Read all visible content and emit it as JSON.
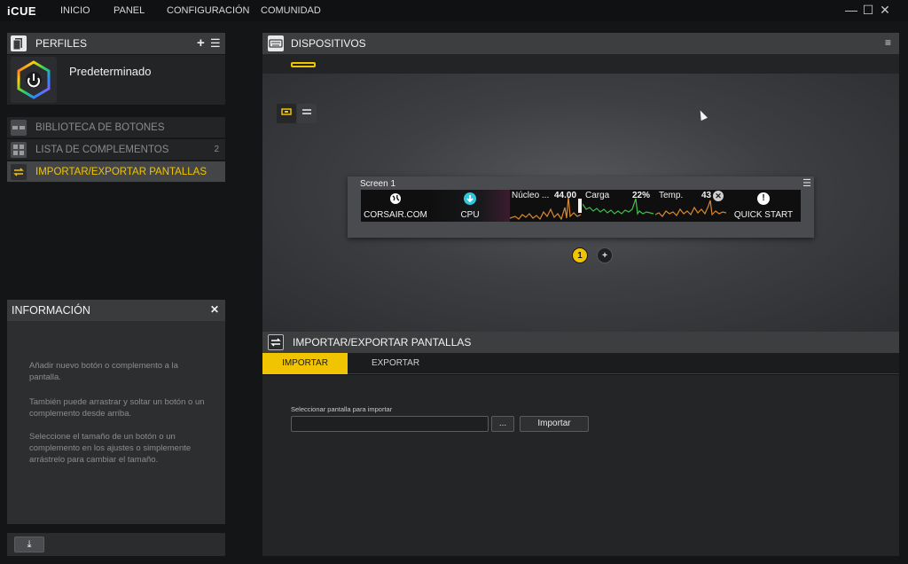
{
  "app": {
    "title": "iCUE",
    "nav": [
      "INICIO",
      "PANEL",
      "CONFIGURACIÓN",
      "COMUNIDAD"
    ],
    "window_controls": {
      "minimize": "—",
      "maximize": "☐",
      "close": "✕"
    }
  },
  "profiles": {
    "title": "PERFILES",
    "add_label": "+",
    "menu_label": "☰",
    "active_profile": "Predeterminado"
  },
  "library": {
    "items": [
      {
        "label": "BIBLIOTECA DE BOTONES",
        "count": "",
        "icon": "buttons-icon"
      },
      {
        "label": "LISTA DE COMPLEMENTOS",
        "count": "2",
        "icon": "grid-icon"
      },
      {
        "label": "IMPORTAR/EXPORTAR PANTALLAS",
        "count": "",
        "icon": "swap-icon"
      }
    ]
  },
  "info": {
    "title": "INFORMACIÓN",
    "close_label": "✕",
    "paragraphs": [
      "Añadir nuevo botón o complemento a la pantalla.",
      "También puede arrastrar y soltar un botón o un complemento desde arriba.",
      "Seleccione el tamaño de un botón o un complemento en los ajustes o simplemente arrástrelo para cambiar el tamaño."
    ],
    "download_label": "⤓"
  },
  "devices": {
    "title": "DISPOSITIVOS",
    "menu_label": "≡"
  },
  "screen": {
    "title": "Screen 1",
    "menu_label": "☰",
    "tiles": [
      {
        "label": "CORSAIR.COM",
        "icon": "globe-icon"
      },
      {
        "label": "CPU",
        "icon": "arrow-down-icon"
      },
      {
        "label": "QUICK START",
        "icon": "alert-icon"
      }
    ],
    "graphs": [
      {
        "label": "Núcleo ...",
        "value": "44.00",
        "color": "#d8872f"
      },
      {
        "label": "Carga",
        "value": "22%",
        "color": "#3fbf4a"
      },
      {
        "label": "Temp.",
        "value": "43",
        "color": "#d8872f"
      }
    ],
    "pages": [
      "1",
      "+"
    ]
  },
  "import_export": {
    "title": "IMPORTAR/EXPORTAR PANTALLAS",
    "tabs": [
      "IMPORTAR",
      "EXPORTAR"
    ],
    "field_label": "Seleccionar pantalla para importar",
    "file_value": "",
    "browse_label": "...",
    "import_button": "Importar"
  },
  "colors": {
    "accent": "#f0c400",
    "background": "#141516",
    "panel": "#2d2e30",
    "cpu_accent": "#2fc7e0"
  }
}
